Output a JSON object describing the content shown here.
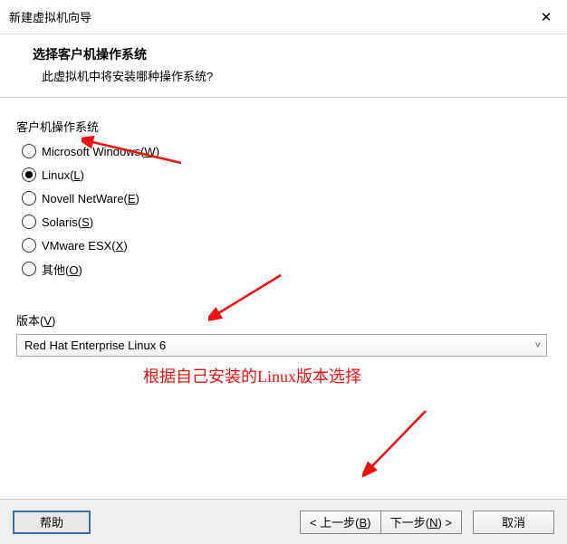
{
  "window": {
    "title": "新建虚拟机向导"
  },
  "header": {
    "heading": "选择客户机操作系统",
    "subheading": "此虚拟机中将安装哪种操作系统?"
  },
  "os_group": {
    "label": "客户机操作系统",
    "options": [
      {
        "label": "Microsoft Windows(",
        "mn": "W",
        "tail": ")",
        "selected": false
      },
      {
        "label": "Linux(",
        "mn": "L",
        "tail": ")",
        "selected": true
      },
      {
        "label": "Novell NetWare(",
        "mn": "E",
        "tail": ")",
        "selected": false
      },
      {
        "label": "Solaris(",
        "mn": "S",
        "tail": ")",
        "selected": false
      },
      {
        "label": "VMware ESX(",
        "mn": "X",
        "tail": ")",
        "selected": false
      },
      {
        "label": "其他(",
        "mn": "O",
        "tail": ")",
        "selected": false
      }
    ]
  },
  "version_group": {
    "label_pre": "版本(",
    "mn": "V",
    "label_post": ")",
    "selected": "Red Hat Enterprise Linux 6"
  },
  "annotation": {
    "note": "根据自己安装的Linux版本选择"
  },
  "footer": {
    "help": "帮助",
    "back_pre": "< 上一步(",
    "back_mn": "B",
    "back_post": ")",
    "next_pre": "下一步(",
    "next_mn": "N",
    "next_post": ") >",
    "cancel": "取消"
  }
}
